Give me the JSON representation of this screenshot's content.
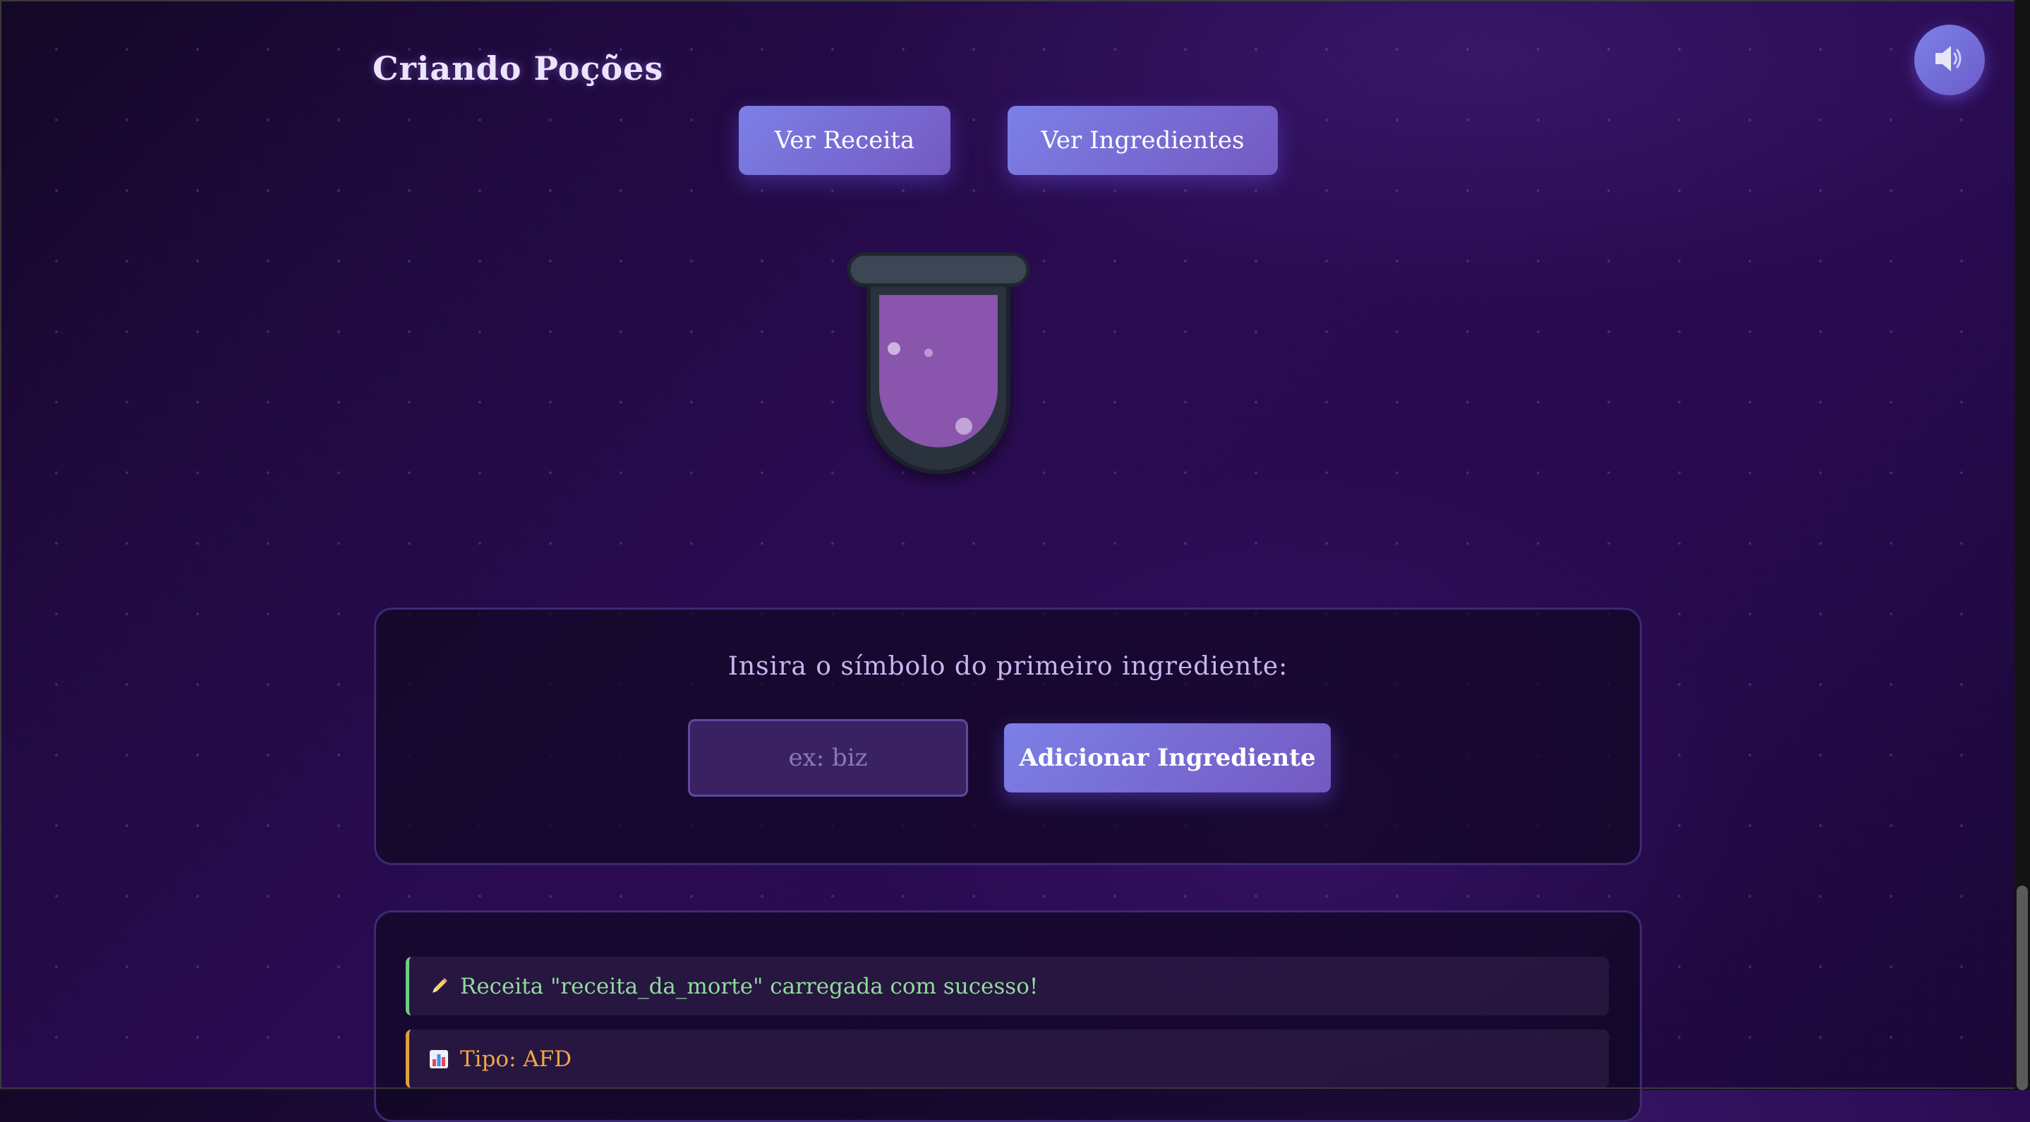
{
  "app": {
    "title": "Criando Poções"
  },
  "sound_button": {
    "icon": "speaker-icon"
  },
  "nav": {
    "view_recipe_label": "Ver Receita",
    "view_ingredients_label": "Ver Ingredientes"
  },
  "cauldron": {
    "liquid_color": "#8a55ad",
    "icon": "cauldron-icon"
  },
  "input_panel": {
    "prompt": "Insira o símbolo do primeiro ingrediente:",
    "input_value": "",
    "input_placeholder": "ex: biz",
    "add_button_label": "Adicionar Ingrediente"
  },
  "log": {
    "entries": [
      {
        "icon": "pencil-icon",
        "text": "Receita \"receita_da_morte\" carregada com sucesso!",
        "status_color": "#6fcf84"
      },
      {
        "icon": "bar-chart-icon",
        "text": "Tipo: AFD",
        "status_color": "#e0a040"
      }
    ]
  },
  "colors": {
    "accent": "#7b80e6",
    "accent_secondary": "#7459c2",
    "background": "#2a0b52",
    "panel_border": "#3b2a73"
  }
}
